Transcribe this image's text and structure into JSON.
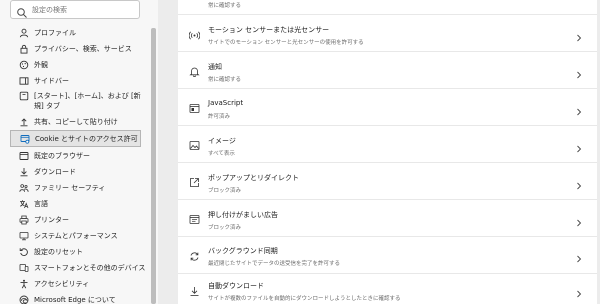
{
  "sidebar": {
    "search_placeholder": "設定の検索",
    "items": [
      {
        "label": "プロファイル",
        "icon": "profile-icon"
      },
      {
        "label": "プライバシー、検索、サービス",
        "icon": "lock-icon"
      },
      {
        "label": "外観",
        "icon": "appearance-icon"
      },
      {
        "label": "サイドバー",
        "icon": "sidebar-icon"
      },
      {
        "label": "[スタート]、[ホーム]、および [新規] タブ",
        "icon": "home-icon"
      },
      {
        "label": "共有、コピーして貼り付け",
        "icon": "share-icon"
      },
      {
        "label": "Cookie とサイトのアクセス許可",
        "icon": "cookie-icon"
      },
      {
        "label": "既定のブラウザー",
        "icon": "browser-icon"
      },
      {
        "label": "ダウンロード",
        "icon": "download-icon"
      },
      {
        "label": "ファミリー セーフティ",
        "icon": "family-icon"
      },
      {
        "label": "言語",
        "icon": "language-icon"
      },
      {
        "label": "プリンター",
        "icon": "printer-icon"
      },
      {
        "label": "システムとパフォーマンス",
        "icon": "system-icon"
      },
      {
        "label": "設定のリセット",
        "icon": "reset-icon"
      },
      {
        "label": "スマートフォンとその他のデバイス",
        "icon": "phone-icon"
      },
      {
        "label": "アクセシビリティ",
        "icon": "accessibility-icon"
      },
      {
        "label": "Microsoft Edge について",
        "icon": "edge-icon"
      }
    ]
  },
  "main": {
    "top_sub": "常に確認する",
    "rows": [
      {
        "title": "モーション センサーまたは光センサー",
        "sub": "サイトでのモーション センサーと光センサーの使用を許可する",
        "icon": "motion-sensor-icon"
      },
      {
        "title": "通知",
        "sub": "常に確認する",
        "icon": "bell-icon"
      },
      {
        "title": "JavaScript",
        "sub": "許可済み",
        "icon": "javascript-icon"
      },
      {
        "title": "イメージ",
        "sub": "すべて表示",
        "icon": "image-icon"
      },
      {
        "title": "ポップアップとリダイレクト",
        "sub": "ブロック済み",
        "icon": "popup-icon"
      },
      {
        "title": "押し付けがましい広告",
        "sub": "ブロック済み",
        "icon": "ads-icon"
      },
      {
        "title": "バックグラウンド同期",
        "sub": "最近閉じたサイトでデータの送受信を完了を許可する",
        "icon": "sync-icon"
      },
      {
        "title": "自動ダウンロード",
        "sub": "サイトが複数のファイルを自動的にダウンロードしようとしたときに確認する",
        "icon": "auto-download-icon"
      }
    ]
  },
  "colors": {
    "page_bg": "#ececec",
    "sidebar_bg": "#f7f7f7",
    "panel_bg": "#ffffff",
    "active_item_bg": "#e4e4e4",
    "accent": "#0f6cbd"
  }
}
